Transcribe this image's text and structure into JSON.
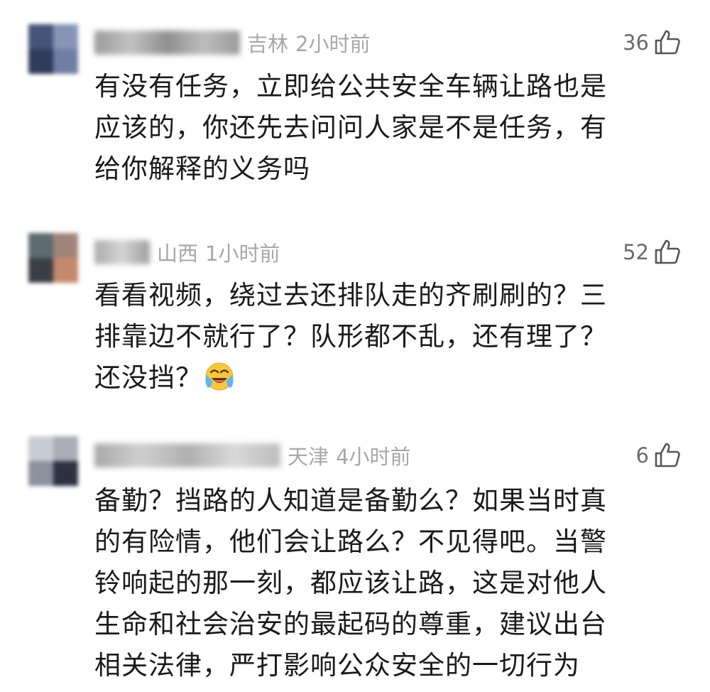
{
  "comments": [
    {
      "location": "吉林",
      "time": "2小时前",
      "likes": "36",
      "text": "有没有任务，立即给公共安全车辆让路也是\n应该的，你还先去问问人家是不是任务，有\n给你解释的义务吗",
      "username_blurred": true,
      "like_icon": "thumbs-up-icon"
    },
    {
      "location": "山西",
      "time": "1小时前",
      "likes": "52",
      "text": "看看视频，绕过去还排队走的齐刷刷的？三\n排靠边不就行了？队形都不乱，还有理了？\n还没挡？",
      "username_blurred": true,
      "like_icon": "thumbs-up-icon",
      "emoji": "crying-laughing-emoji"
    },
    {
      "location": "天津",
      "time": "4小时前",
      "likes": "6",
      "text": "备勤？挡路的人知道是备勤么？如果当时真\n的有险情，他们会让路么？不见得吧。当警\n铃响起的那一刻，都应该让路，这是对他人\n生命和社会治安的最起码的尊重，建议出台\n相关法律，严打影响公众安全的一切行为",
      "username_blurred": true,
      "like_icon": "thumbs-up-icon"
    }
  ],
  "colors": {
    "text": "#1a1a1a",
    "meta": "#a7a7a7",
    "like_count": "#6b6b6b",
    "background": "#ffffff"
  }
}
